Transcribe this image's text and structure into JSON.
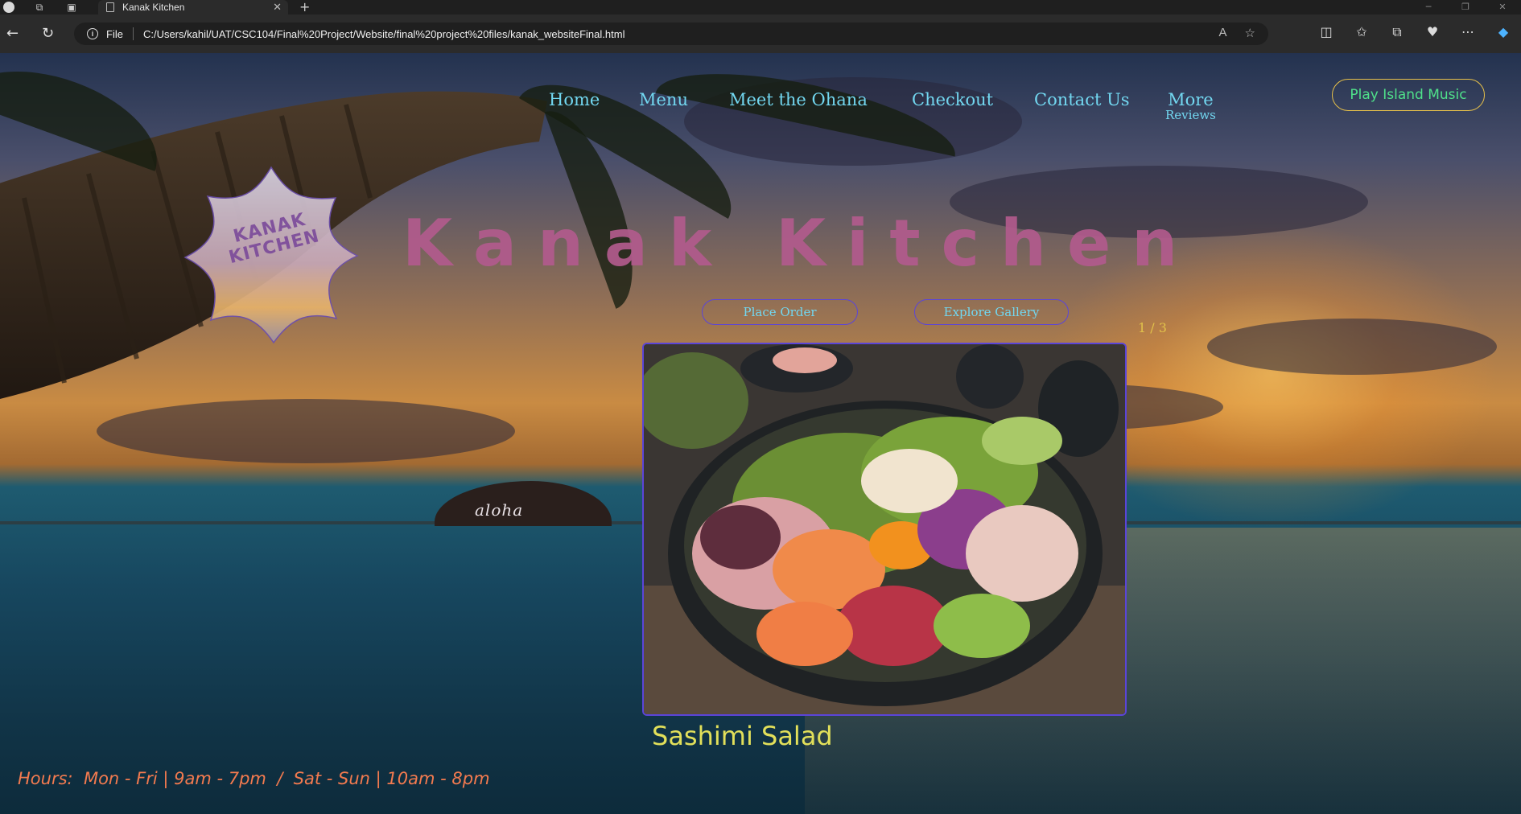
{
  "browser": {
    "tab_title": "Kanak Kitchen",
    "tab_close": "✕",
    "new_tab": "+",
    "file_label": "File",
    "url": "C:/Users/kahil/UAT/CSC104/Final%20Project/Website/final%20project%20files/kanak_websiteFinal.html"
  },
  "nav": {
    "items": [
      "Home",
      "Menu",
      "Meet the Ohana",
      "Checkout",
      "Contact Us"
    ],
    "more": "More",
    "more_sub": "Reviews"
  },
  "music_button": "Play Island Music",
  "logo": {
    "line1": "KANAK",
    "line2": "KITCHEN"
  },
  "title": "Kanak Kitchen",
  "buttons": {
    "order": "Place Order",
    "gallery": "Explore Gallery"
  },
  "slideshow": {
    "current": 1,
    "total": 3,
    "counter": "1 / 3",
    "caption": "Sashimi Salad"
  },
  "island_text": "aloha",
  "hours": "Hours:  Mon - Fri | 9am - 7pm  /  Sat - Sun | 10am - 8pm",
  "colors": {
    "nav": "#72d7f0",
    "title": "#b25b8d",
    "accent_border": "#5b45d8",
    "music_text": "#4fe08a",
    "music_border": "#e6c04a",
    "caption": "#e2e05a",
    "hours": "#f27a4f"
  }
}
